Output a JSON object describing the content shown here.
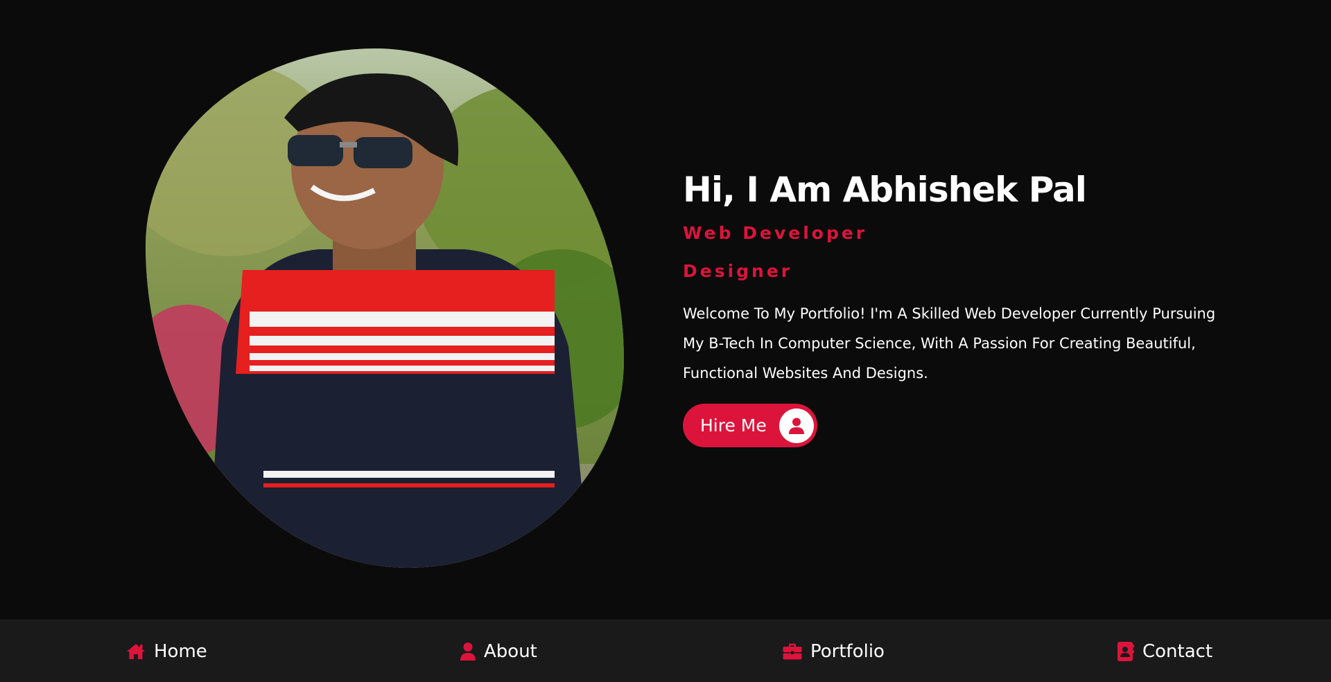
{
  "hero": {
    "photo_alt": "Portrait photo",
    "title": "Hi, I Am Abhishek Pal",
    "roles": [
      "Web Developer",
      "Designer"
    ],
    "description": "Welcome To My Portfolio! I'm A Skilled Web Developer Currently Pursuing My B-Tech In Computer Science, With A Passion For Creating Beautiful, Functional Websites And Designs.",
    "hire_button": {
      "label": "Hire Me",
      "icon": "user-icon"
    }
  },
  "nav": {
    "items": [
      {
        "label": "Home",
        "icon": "home-icon"
      },
      {
        "label": "About",
        "icon": "user-icon"
      },
      {
        "label": "Portfolio",
        "icon": "briefcase-icon"
      },
      {
        "label": "Contact",
        "icon": "contact-book-icon"
      }
    ]
  },
  "colors": {
    "background": "#0b0b0b",
    "nav_background": "#1a1a1a",
    "accent": "#dc143c",
    "text": "#ffffff"
  }
}
